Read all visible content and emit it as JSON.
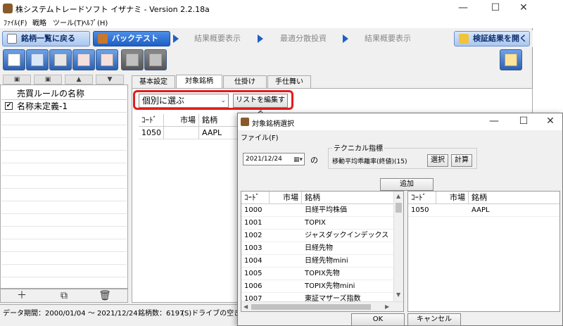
{
  "main": {
    "title": "株システムトレードソフト イザナミ - Version 2.2.18a",
    "menu": [
      "ﾌｧｲﾙ(F)",
      "戦略",
      "ツール(T)",
      "ﾍﾙﾌﾟ(H)"
    ],
    "nav_tabs": {
      "back": "銘柄一覧に戻る",
      "backtest": "バックテスト",
      "summary1": "結果概要表示",
      "optimize": "最適分散投資",
      "summary2": "結果概要表示",
      "open_results": "検証結果を開く"
    },
    "left_panel": {
      "header": "売買ルールの名称",
      "rows": [
        {
          "label": "名称未定義-1",
          "checked": true
        }
      ]
    },
    "sub_tabs": [
      "基本設定",
      "対象銘柄",
      "仕掛け",
      "手仕舞い"
    ],
    "active_sub_tab": "対象銘柄",
    "select_value": "個別に選ぶ",
    "edit_list_button": "リストを編集する",
    "grid": {
      "headers": [
        "ｺｰﾄﾞ",
        "市場",
        "銘柄"
      ],
      "rows": [
        [
          "1050",
          "",
          "AAPL"
        ]
      ]
    },
    "status": {
      "period": "データ期間：2000/01/04 〜 2021/12/24",
      "count": "銘柄数：6197",
      "drive": "(S)ドライブの空き"
    }
  },
  "dialog": {
    "title": "対象銘柄選択",
    "menu": "ファイル(F)",
    "date": "2021/12/24",
    "no_label": "の",
    "technical_label": "テクニカル指標",
    "technical_value": "移動平均乖離率(終値)(15)",
    "select_button": "選択",
    "calc_button": "計算",
    "add_button": "追加",
    "left_grid": {
      "headers": [
        "ｺｰﾄﾞ",
        "市場",
        "銘柄"
      ],
      "rows": [
        [
          "1000",
          "",
          "日経平均株価"
        ],
        [
          "1001",
          "",
          "TOPIX"
        ],
        [
          "1002",
          "",
          "ジャスダックインデックス"
        ],
        [
          "1003",
          "",
          "日経先物"
        ],
        [
          "1004",
          "",
          "日経先物mini"
        ],
        [
          "1005",
          "",
          "TOPIX先物"
        ],
        [
          "1006",
          "",
          "TOPIX先物mini"
        ],
        [
          "1007",
          "",
          "東証マザーズ指数"
        ]
      ]
    },
    "right_grid": {
      "headers": [
        "ｺｰﾄﾞ",
        "市場",
        "銘柄"
      ],
      "rows": [
        [
          "1050",
          "",
          "AAPL"
        ]
      ]
    },
    "ok_button": "OK",
    "cancel_button": "キャンセル"
  }
}
